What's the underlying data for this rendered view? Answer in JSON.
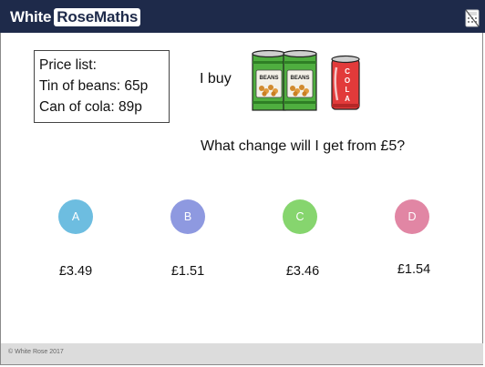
{
  "header": {
    "logo_part1": "White",
    "logo_part2": "RoseMaths",
    "calculator_icon": "no-calculator-icon"
  },
  "price_list": {
    "title": "Price list:",
    "item1": "Tin of beans: 65p",
    "item2": "Can of cola: 89p"
  },
  "purchase": {
    "text": "I buy",
    "images": [
      "two-bean-tins",
      "cola-can"
    ],
    "bean_label": "BEANS",
    "cola_letters": [
      "C",
      "O",
      "L",
      "A"
    ]
  },
  "question": "What change will I get from £5?",
  "options": [
    {
      "letter": "A",
      "value": "£3.49",
      "color": "#6dbde0"
    },
    {
      "letter": "B",
      "value": "£1.51",
      "color": "#8e99e0"
    },
    {
      "letter": "C",
      "value": "£3.46",
      "color": "#86d56e"
    },
    {
      "letter": "D",
      "value": "£1.54",
      "color": "#e186a4"
    }
  ],
  "footer": {
    "copyright": "© White Rose 2017"
  }
}
